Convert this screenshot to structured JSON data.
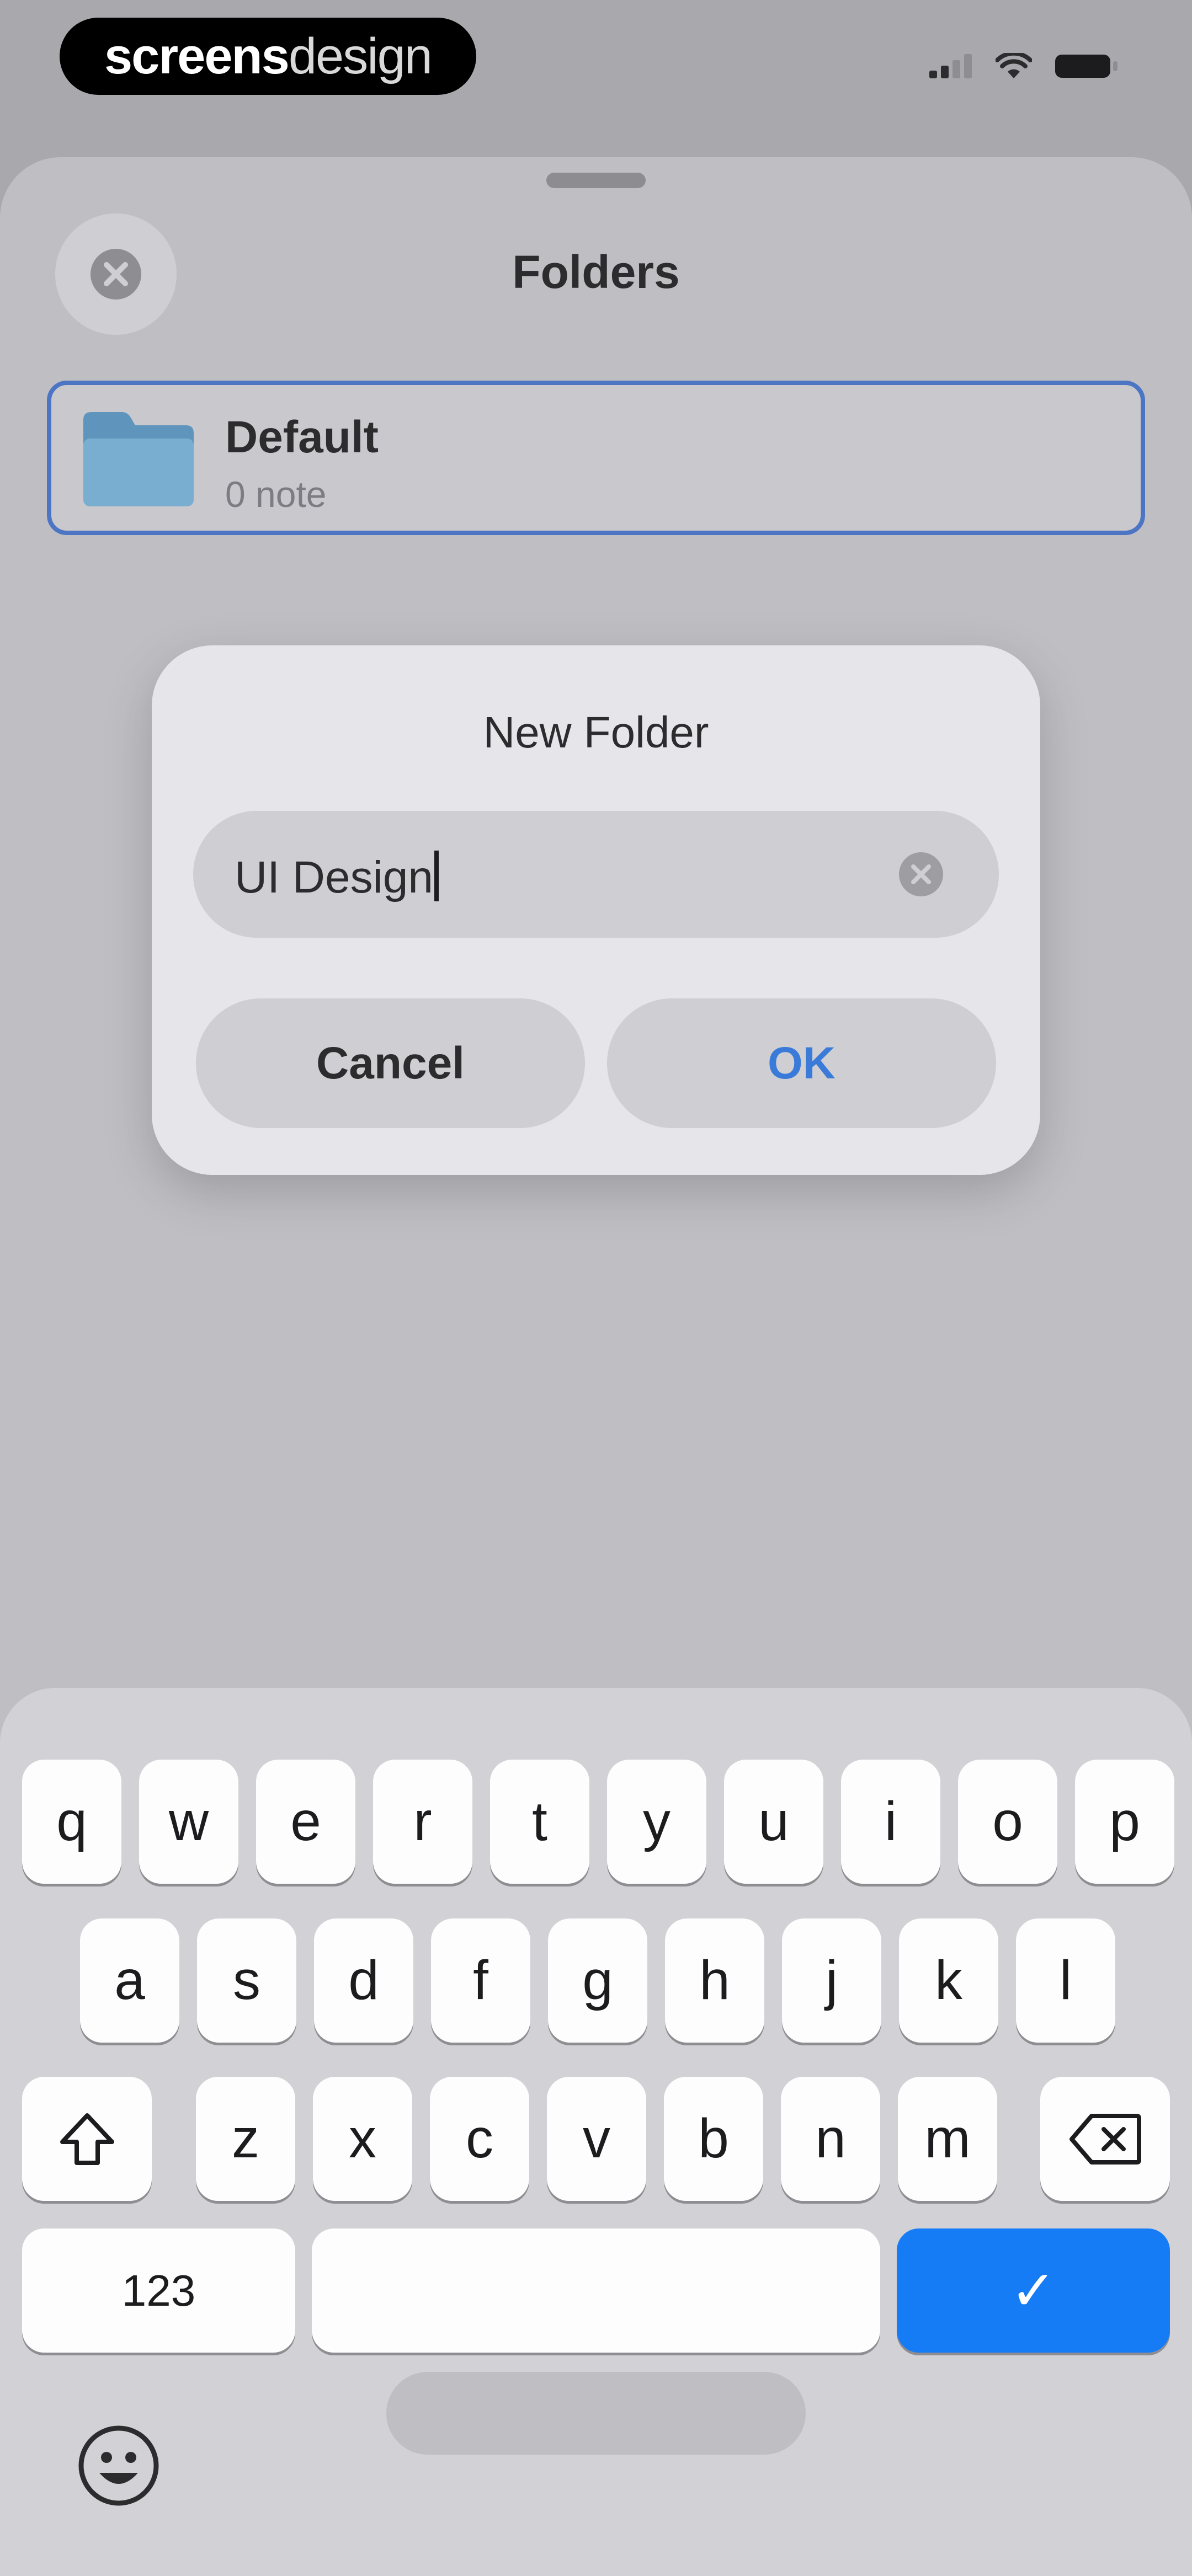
{
  "status_bar": {
    "brand_bold": "screens",
    "brand_light": "design",
    "icons": [
      "cellular-signal-icon",
      "wifi-icon",
      "battery-icon"
    ]
  },
  "sheet": {
    "title": "Folders",
    "close_icon": "close-circle-icon",
    "folders": [
      {
        "name": "Default",
        "count": "0 note",
        "icon": "folder-icon",
        "selected": true
      }
    ]
  },
  "dialog": {
    "title": "New Folder",
    "field_value": "UI Design",
    "clear_icon": "clear-icon",
    "cancel_label": "Cancel",
    "ok_label": "OK"
  },
  "keyboard": {
    "row1": [
      "q",
      "w",
      "e",
      "r",
      "t",
      "y",
      "u",
      "i",
      "o",
      "p"
    ],
    "row2": [
      "a",
      "s",
      "d",
      "f",
      "g",
      "h",
      "j",
      "k",
      "l"
    ],
    "row3": [
      "z",
      "x",
      "c",
      "v",
      "b",
      "n",
      "m"
    ],
    "numbers_label": "123",
    "done_glyph": "✓",
    "shift_icon": "shift-icon",
    "delete_icon": "backspace-icon",
    "emoji_icon": "emoji-icon"
  },
  "colors": {
    "accent": "#167cf5",
    "ok_text": "#3a7bd9",
    "selection_border": "#4c76c4",
    "folder": "#6fa3c6"
  }
}
